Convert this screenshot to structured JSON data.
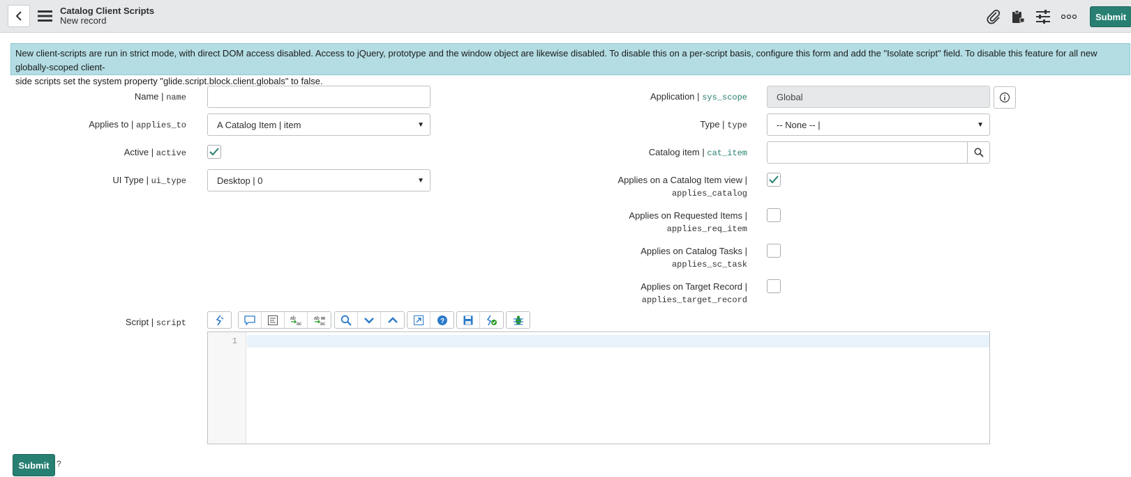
{
  "header": {
    "title": "Catalog Client Scripts",
    "subtitle": "New record",
    "submit_label": "Submit"
  },
  "banner": {
    "line1": "New client-scripts are run in strict mode, with direct DOM access disabled. Access to jQuery, prototype and the window object are likewise disabled. To disable this on a per-script basis, configure this form and add the \"Isolate script\" field. To disable this feature for all new globally-scoped client-",
    "line2": "side scripts set the system property \"glide.script.block.client.globals\" to false."
  },
  "form": {
    "name": {
      "label": "Name",
      "field": "name",
      "value": ""
    },
    "applies_to": {
      "label": "Applies to",
      "field": "applies_to",
      "value": "A Catalog Item | item"
    },
    "active": {
      "label": "Active",
      "field": "active",
      "checked": true
    },
    "ui_type": {
      "label": "UI Type",
      "field": "ui_type",
      "value": "Desktop | 0"
    },
    "application": {
      "label": "Application",
      "field": "sys_scope",
      "value": "Global"
    },
    "type": {
      "label": "Type",
      "field": "type",
      "value": "-- None -- |"
    },
    "catalog_item": {
      "label": "Catalog item",
      "field": "cat_item",
      "value": ""
    },
    "applies_catalog": {
      "label": "Applies on a Catalog Item view |",
      "field": "applies_catalog",
      "checked": true
    },
    "applies_req_item": {
      "label": "Applies on Requested Items |",
      "field": "applies_req_item",
      "checked": false
    },
    "applies_sc_task": {
      "label": "Applies on Catalog Tasks |",
      "field": "applies_sc_task",
      "checked": false
    },
    "applies_target_record": {
      "label": "Applies on Target Record |",
      "field": "applies_target_record",
      "checked": false
    },
    "script": {
      "label": "Script",
      "field": "script",
      "line_number": "1"
    }
  },
  "separator": "|",
  "footer": {
    "submit_label": "Submit",
    "help": "?"
  },
  "colors": {
    "accent": "#278072",
    "banner": "#b3dde3",
    "header": "#e6e8ea"
  }
}
